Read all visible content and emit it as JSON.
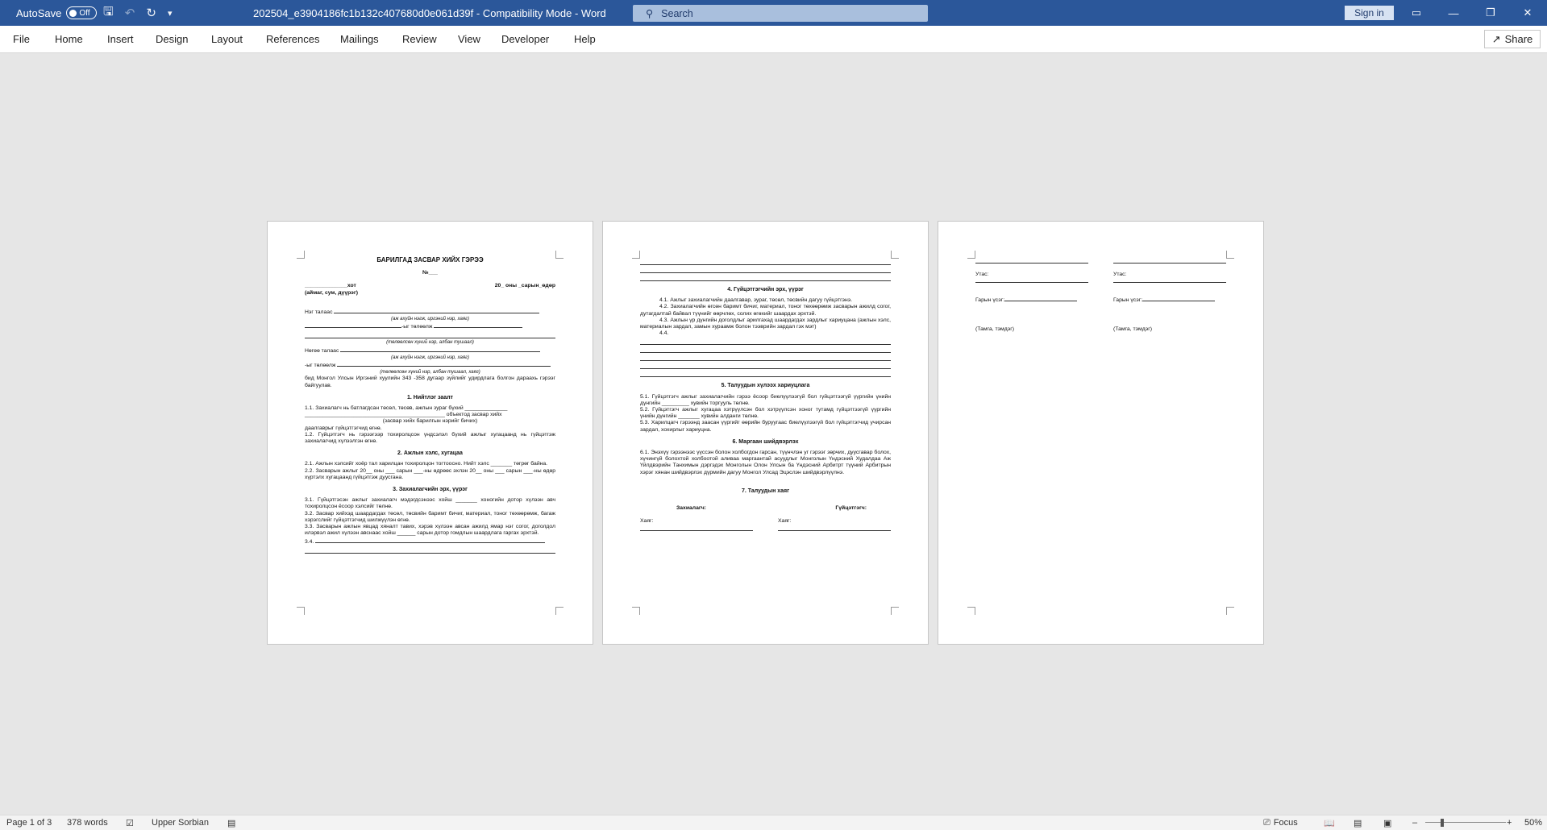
{
  "titlebar": {
    "autosave_label": "AutoSave",
    "autosave_state": "Off",
    "document_title": "202504_e3904186fc1b132c407680d0e061d39f  -  Compatibility Mode  -  Word",
    "search_placeholder": "Search",
    "sign_in": "Sign in"
  },
  "ribbon": {
    "tabs": [
      "File",
      "Home",
      "Insert",
      "Design",
      "Layout",
      "References",
      "Mailings",
      "Review",
      "View",
      "Developer",
      "Help"
    ],
    "share": "Share"
  },
  "page1": {
    "title": "БАРИЛГАД ЗАСВАР ХИЙХ ГЭРЭЭ",
    "number": "№___",
    "city": "______________хот",
    "date": "20_ оны _сарын_өдөр",
    "location_note": "(аймаг, сум, дүүрэг)",
    "party1": "Нэг талаас",
    "party_hint1": "(аж ахуйн нэгж, иргэний нэр, хаяг)",
    "represented": "-ыг   төлөөлж",
    "rep_hint1": "(төлөөлсөн хүний нэр, албан тушаал)",
    "party2": "Нөгөө талаас",
    "party_hint2": "(аж ахуйн нэгж, иргэний нэр, хаяг)",
    "represented2": "-ыг төлөөлж",
    "rep_hint2": "(төлөөлсөн хүний нэр, албан тушаал, хаяг)",
    "intro": "бид Монгол Улсын Иргэний хуулийн 343 -358 дугаар зүйлийг удирдлага болгон дараахь гэрээг байгуулав.",
    "s1_heading": "1. Нийтлэг заалт",
    "s1_1a": "1.1. Захиалагч нь батлагдсан төсөл, төсөв, ажлын зураг бүхий ______________",
    "s1_1b": "______________________________________________ объектод засвар хийх",
    "s1_1c": "(засвар хийх барилгын нэрийг бичих)",
    "s1_1d": "даалгаврыг гүйцэтгэгчид өгнө.",
    "s1_2": "1.2. Гүйцэтгэгч нь гэрээгээр тохиролцсон үндсэлэл бүхий ажлыг хугацаанд нь гүйцэтгэж захиалагчид хүлээлгэн өгнө.",
    "s2_heading": "2. Ажлын хэлс, хугацаа",
    "s2_1": "2.1. Ажлын хэлсийг хоёр тал харилцан тохиролцон тогтоосно. Нийт хэлс _______ төгрөг байна.",
    "s2_2": "2.2. Засварын ажлыг 20__ оны ___ сарын ___-ны өдрөөс эхлэн 20__ оны ___ сарын ___-ны өдөр хүртэлх хугацаанд гүйцэтгэж дуусгана.",
    "s3_heading": "3. Захиалагчийн эрх, үүрэг",
    "s3_1": "3.1. Гүйцэтгэсэн ажлыг захиалагч мэдэгдсэнээс хойш _______ хоногийн дотор хүлээн авч тохиролцсон ёсоор хэлсийг төлнө.",
    "s3_2": "3.2. Засвар хийхэд шаардагдах төсөл, төсвийн баримт бичиг, материал, тоног төхөөрөмж, багаж хэрэгслийг гүйцэтгэгчид шилжүүлэн өгнө.",
    "s3_3": "3.3. Засварын ажлын явцад хяналт тавих, хэрэв хүлээн авсан ажилд ямар нэг согог, доголдол илэрвэл ажил хүлээн авснаас хойш ______ сарын дотор гомдлын шаардлага гаргах эрхтэй.",
    "s3_4": "3.4."
  },
  "page2": {
    "s4_heading": "4. Гүйцэтгэгчийн эрх, үүрэг",
    "s4_1": "4.1. Ажлыг захиалагчийн даалгавар, зураг, төсөл, төсвийн дагуу гүйцэтгэнэ.",
    "s4_2": "4.2. Захиалагчийн өгсөн баримт бичиг, материал, тоног төхөөрөмж засварын ажилд согог, дутагдалтай байвал түүнийг өөрчлөх, солих өгөхийг шаардах эрхтэй.",
    "s4_3": "4.3. Ажлын үр дүнгийн доголдлыг арилгахад шаардагдах зардлыг хариуцана (ажлын хэлс, материалын зардал, замын хураамж болон тээврийн зардал гэх мэт)",
    "s4_4": "4.4.",
    "s5_heading": "5. Талуудын хүлээх хариуцлага",
    "s5_1": "5.1. Гүйцэтгэгч ажлыг захиалагчийн гэрээ ёсоор биелүүлээгүй бол гүйцэтгээгүй үүргийн үнийн дүнгийн _________ хувийн торгууль төлнө.",
    "s5_2": "5.2. Гүйцэтгэгч ажлыг хугацаа хэтрүүлсэн бол хэтрүүлсэн хоног тутамд гүйцэтгээгүй үүргийн үнийн дүнгийн _______ хувийн алданги төлнө.",
    "s5_3": "5.3. Харилцагч гэрээнд заасан үүргийг өөрийн буруугаас биелүүлээгүй бол гүйцэтгэгчид учирсан зардал, хохирлыг хариуцна.",
    "s6_heading": "6. Маргаан шийдвэрлэх",
    "s6_1": "6.1. Энэхүү гэрээнээс үүссэн болон холбогдон гарсан, түүнчлэн уг гэрээг зөрчих, дуусгавар болох, хүчингүй болохтой холбоотой аливаа маргаантай асуудлыг Монголын Үндэсний Худалдаа Аж Үйлдвэрийн Танхимын дэргэдэх Монголын Олон Улсын ба Үндэсний Арбитрт түүний Арбитрын хэрэг хянан шийдвэрлэх дүрмийн дагуу Монгол Улсад Эцэслэн шийдвэрлүүлнэ.",
    "s7_heading": "7. Талуудын хаяг",
    "client_label": "Захиалагч:",
    "contractor_label": "Гүйцэтгэгч:",
    "address_label1": "Хаяг:",
    "address_label2": "Хаяг:"
  },
  "page3": {
    "phone_label1": "Утас:",
    "phone_label2": "Утас:",
    "signature_label1": "Гарын үсэг:",
    "signature_label2": "Гарын үсэг:",
    "stamp_label1": "(Тамга, тэмдэг)",
    "stamp_label2": "(Тамга, тэмдэг)"
  },
  "statusbar": {
    "page": "Page 1 of 3",
    "words": "378 words",
    "language": "Upper Sorbian",
    "focus": "Focus",
    "zoom": "50%"
  }
}
